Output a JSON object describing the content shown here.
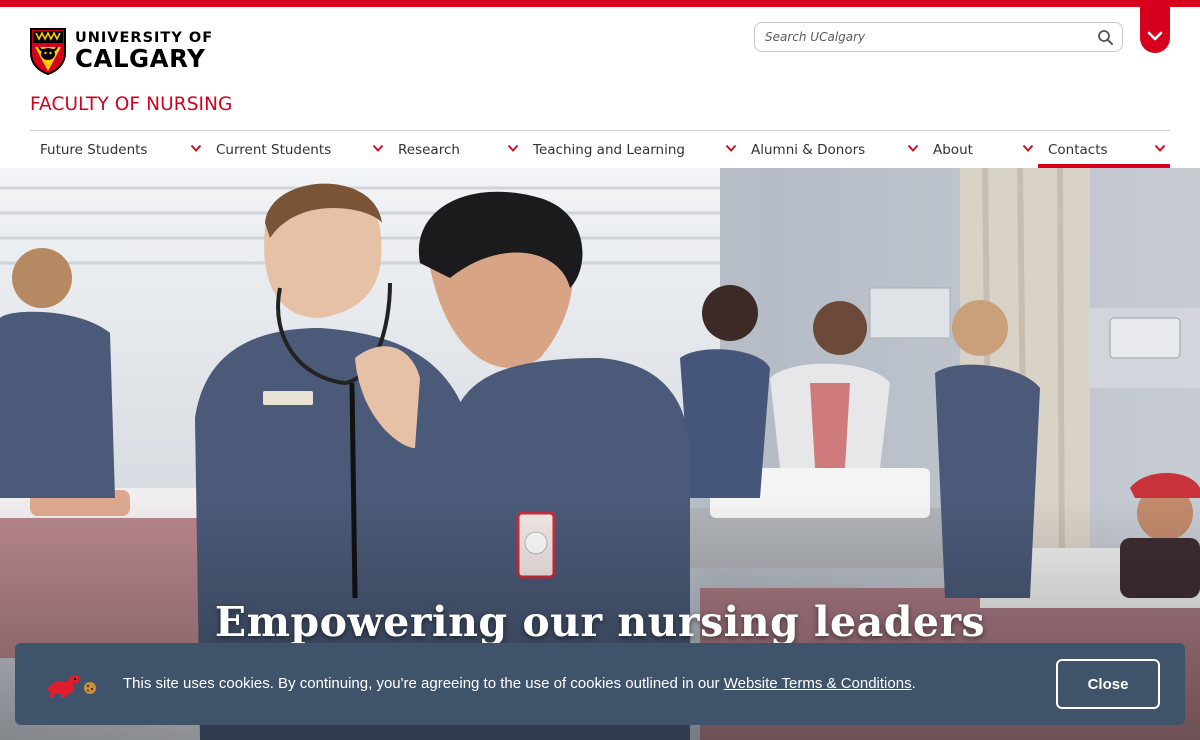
{
  "logo": {
    "line1": "UNIVERSITY OF",
    "line2": "CALGARY"
  },
  "search": {
    "placeholder": "Search UCalgary"
  },
  "faculty_title": "FACULTY OF NURSING",
  "nav": {
    "items": [
      {
        "label": "Future Students"
      },
      {
        "label": "Current Students"
      },
      {
        "label": "Research"
      },
      {
        "label": "Teaching and Learning"
      },
      {
        "label": "Alumni & Donors"
      },
      {
        "label": "About"
      },
      {
        "label": "Contacts",
        "active": true
      }
    ]
  },
  "hero": {
    "title": "Empowering our nursing leaders"
  },
  "cookie": {
    "text": "This site uses cookies. By continuing, you're agreeing to the use of cookies outlined in our",
    "link_text": "Website Terms & Conditions",
    "suffix": ".",
    "close_label": "Close"
  },
  "icons": [
    "crest-logo-icon",
    "search-icon",
    "chevron-down-icon",
    "dinosaur-icon",
    "cookie-icon"
  ],
  "colors": {
    "brand_red": "#d6001c",
    "banner_bg": "#3f536a",
    "scrubs": "#4a5a78"
  }
}
